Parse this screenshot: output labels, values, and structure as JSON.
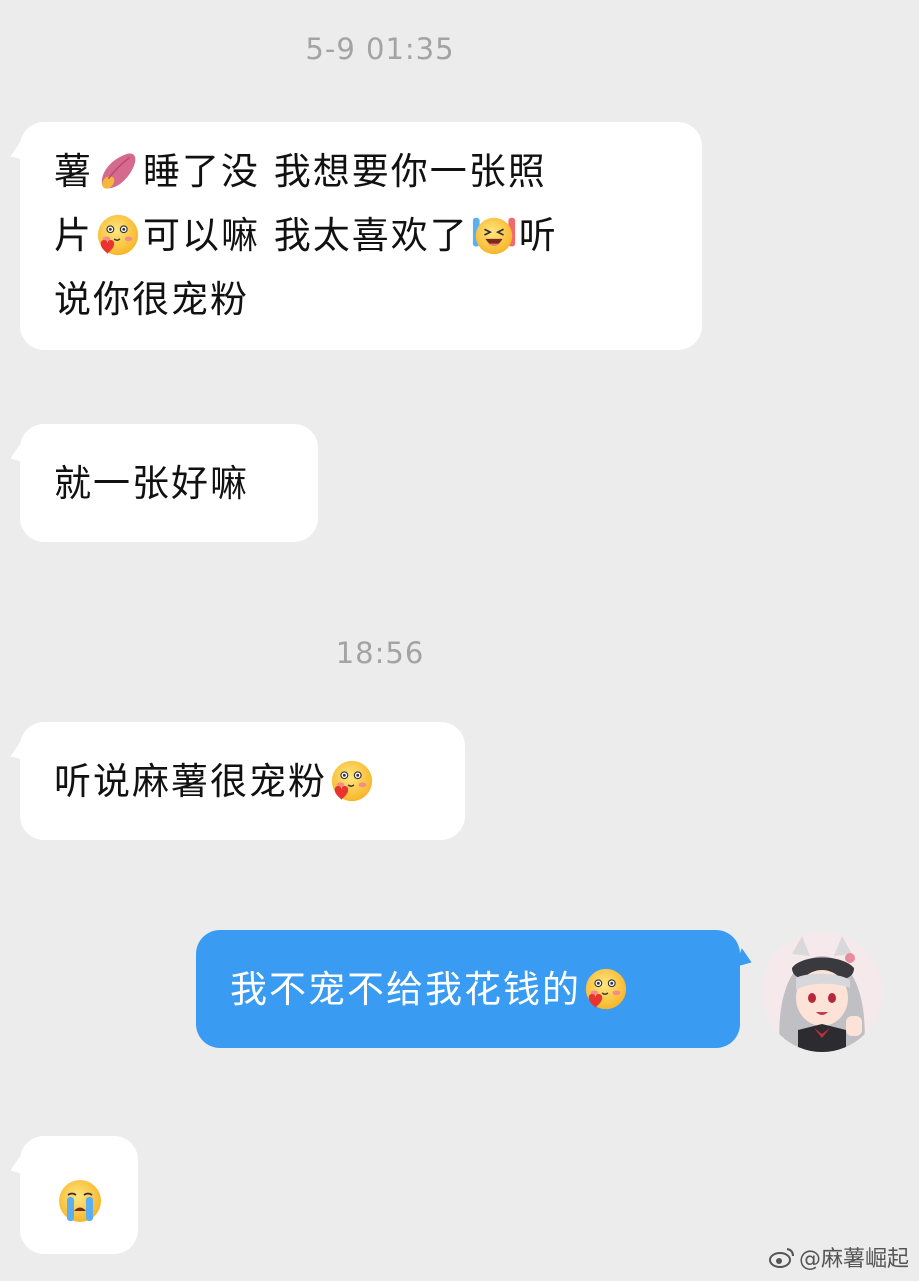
{
  "timestamps": [
    "5-9 01:35",
    "18:56"
  ],
  "messages": [
    {
      "side": "left",
      "parts": [
        "薯",
        "sweet-potato-emoji",
        "睡了没 我想要你一张照片",
        "blush-heart-emoji",
        "可以嘛 我太喜欢了",
        "screaming-joy-emoji",
        "听说你很宠粉"
      ]
    },
    {
      "side": "left",
      "parts": [
        "就一张好嘛"
      ]
    },
    {
      "side": "left",
      "parts": [
        "听说麻薯很宠粉",
        "blush-heart-emoji"
      ]
    },
    {
      "side": "right",
      "parts": [
        "我不宠不给我花钱的",
        "blush-heart-emoji"
      ]
    },
    {
      "side": "left",
      "parts": [
        "crying-emoji"
      ]
    }
  ],
  "text": {
    "m1_a": "薯",
    "m1_b": "睡了没 我想要你一张照",
    "m1_c": "片",
    "m1_d": "可以嘛 我太喜欢了",
    "m1_e": "听",
    "m1_f": "说你很宠粉",
    "m2": "就一张好嘛",
    "m3": "听说麻薯很宠粉",
    "m4": "我不宠不给我花钱的"
  },
  "watermark": "@麻薯崛起",
  "colors": {
    "background": "#ececec",
    "incoming_bubble": "#ffffff",
    "outgoing_bubble": "#3a9bf3",
    "timestamp": "#a3a3a3"
  },
  "icons": [
    "sweet-potato-emoji",
    "blush-heart-emoji",
    "screaming-joy-emoji",
    "crying-emoji",
    "weibo-logo-icon",
    "user-avatar"
  ]
}
